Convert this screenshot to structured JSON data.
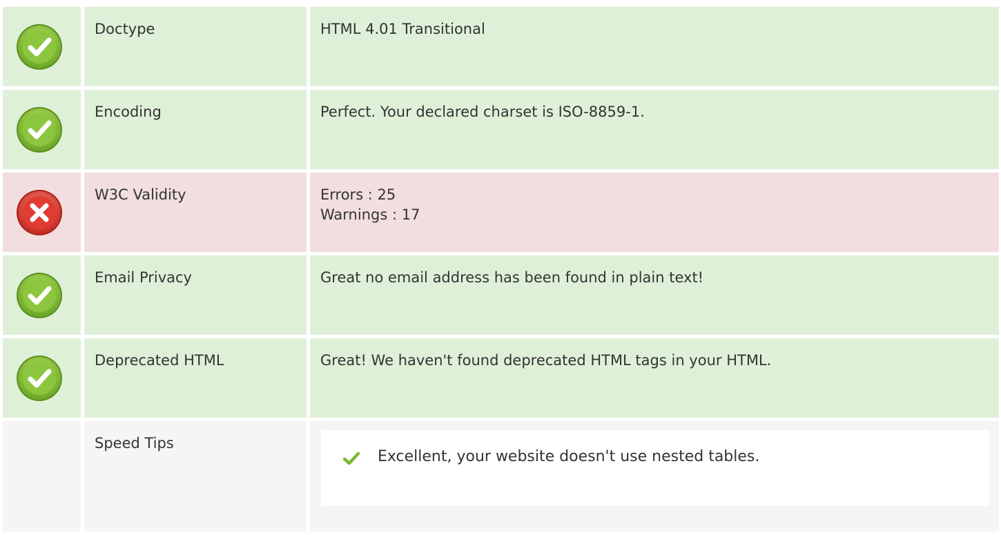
{
  "colors": {
    "ok_bg": "#dff0d8",
    "error_bg": "#f2dede",
    "neutral_bg": "#f5f5f5",
    "ok_icon": "#8cc63f",
    "error_icon": "#e03c31",
    "text": "#333333"
  },
  "rows": [
    {
      "status": "ok",
      "icon": "check-circle-icon",
      "label": "Doctype",
      "value": "HTML 4.01 Transitional"
    },
    {
      "status": "ok",
      "icon": "check-circle-icon",
      "label": "Encoding",
      "value": "Perfect. Your declared charset is ISO-8859-1."
    },
    {
      "status": "error",
      "icon": "error-circle-icon",
      "label": "W3C Validity",
      "value_lines": [
        "Errors : 25",
        "Warnings : 17"
      ]
    },
    {
      "status": "ok",
      "icon": "check-circle-icon",
      "label": "Email Privacy",
      "value": "Great no email address has been found in plain text!"
    },
    {
      "status": "ok",
      "icon": "check-circle-icon",
      "label": "Deprecated HTML",
      "value": "Great! We haven't found deprecated HTML tags in your HTML."
    }
  ],
  "speed_tips": {
    "label": "Speed Tips",
    "items": [
      {
        "icon": "checkmark-icon",
        "text": "Excellent, your website doesn't use nested tables."
      }
    ]
  }
}
